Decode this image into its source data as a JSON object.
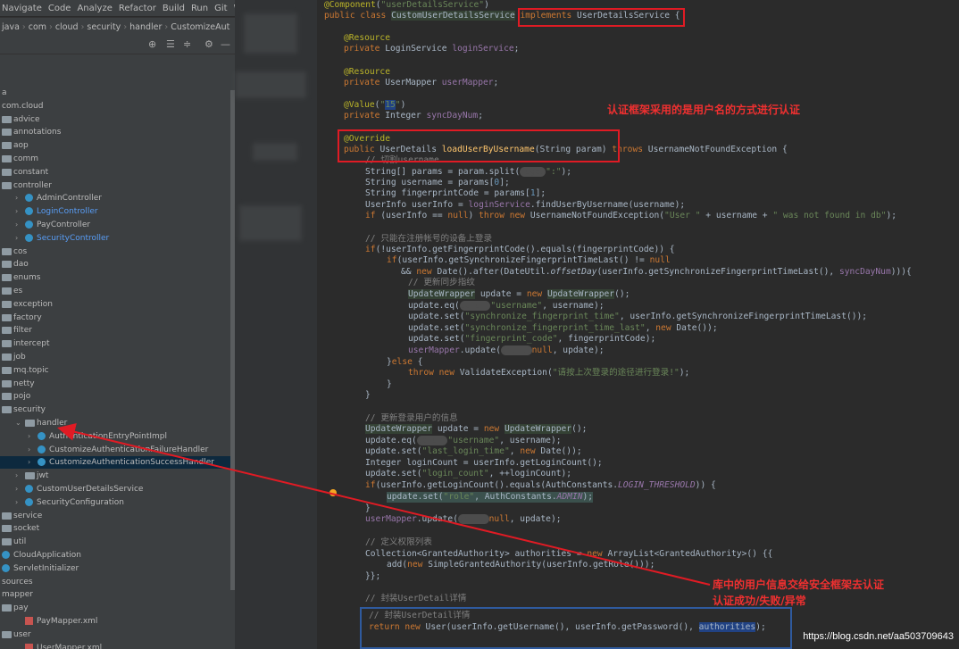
{
  "menu": [
    "Navigate",
    "Code",
    "Analyze",
    "Refactor",
    "Build",
    "Run",
    "Git",
    "W"
  ],
  "breadcrumbs": [
    "java",
    "com",
    "cloud",
    "security",
    "handler",
    "CustomizeAut"
  ],
  "tree": [
    {
      "t": "a",
      "lvl": 0
    },
    {
      "t": "com.cloud",
      "lvl": 0
    },
    {
      "t": "advice",
      "lvl": 0,
      "folder": true
    },
    {
      "t": "annotations",
      "lvl": 0,
      "folder": true
    },
    {
      "t": "aop",
      "lvl": 0,
      "folder": true
    },
    {
      "t": "comm",
      "lvl": 0,
      "folder": true
    },
    {
      "t": "constant",
      "lvl": 0,
      "folder": true
    },
    {
      "t": "controller",
      "lvl": 0,
      "folder": true
    },
    {
      "t": "AdminController",
      "lvl": 1,
      "cls": true
    },
    {
      "t": "LoginController",
      "lvl": 1,
      "cls": true,
      "blue": true
    },
    {
      "t": "PayController",
      "lvl": 1,
      "cls": true
    },
    {
      "t": "SecurityController",
      "lvl": 1,
      "cls": true,
      "blue": true
    },
    {
      "t": "cos",
      "lvl": 0,
      "folder": true
    },
    {
      "t": "dao",
      "lvl": 0,
      "folder": true
    },
    {
      "t": "enums",
      "lvl": 0,
      "folder": true
    },
    {
      "t": "es",
      "lvl": 0,
      "folder": true
    },
    {
      "t": "exception",
      "lvl": 0,
      "folder": true
    },
    {
      "t": "factory",
      "lvl": 0,
      "folder": true
    },
    {
      "t": "filter",
      "lvl": 0,
      "folder": true
    },
    {
      "t": "intercept",
      "lvl": 0,
      "folder": true
    },
    {
      "t": "job",
      "lvl": 0,
      "folder": true
    },
    {
      "t": "mq.topic",
      "lvl": 0,
      "folder": true
    },
    {
      "t": "netty",
      "lvl": 0,
      "folder": true
    },
    {
      "t": "pojo",
      "lvl": 0,
      "folder": true
    },
    {
      "t": "security",
      "lvl": 0,
      "folder": true
    },
    {
      "t": "handler",
      "lvl": 1,
      "folder": true
    },
    {
      "t": "AuthenticationEntryPointImpl",
      "lvl": 2,
      "cls": true
    },
    {
      "t": "CustomizeAuthenticationFailureHandler",
      "lvl": 2,
      "cls": true
    },
    {
      "t": "CustomizeAuthenticationSuccessHandler",
      "lvl": 2,
      "cls": true,
      "sel": true
    },
    {
      "t": "jwt",
      "lvl": 1,
      "folder": true
    },
    {
      "t": "CustomUserDetailsService",
      "lvl": 1,
      "cls": true
    },
    {
      "t": "SecurityConfiguration",
      "lvl": 1,
      "cls": true
    },
    {
      "t": "service",
      "lvl": 0,
      "folder": true
    },
    {
      "t": "socket",
      "lvl": 0,
      "folder": true
    },
    {
      "t": "util",
      "lvl": 0,
      "folder": true
    },
    {
      "t": "CloudApplication",
      "lvl": 0,
      "cls": true
    },
    {
      "t": "ServletInitializer",
      "lvl": 0,
      "cls": true
    },
    {
      "t": "sources",
      "lvl": 0
    },
    {
      "t": "mapper",
      "lvl": 0
    },
    {
      "t": "pay",
      "lvl": 0,
      "folder": true
    },
    {
      "t": "PayMapper.xml",
      "lvl": 1,
      "xml": true
    },
    {
      "t": "user",
      "lvl": 0,
      "folder": true
    },
    {
      "t": "UserMapper.xml",
      "lvl": 1,
      "xml": true
    }
  ],
  "annotations": {
    "a1": "认证框架采用的是用户名的方式进行认证",
    "a2_line1": "库中的用户信息交给安全框架去认证",
    "a2_line2": "认证成功/失败/异常"
  },
  "watermark": "https://blog.csdn.net/aa503709643"
}
